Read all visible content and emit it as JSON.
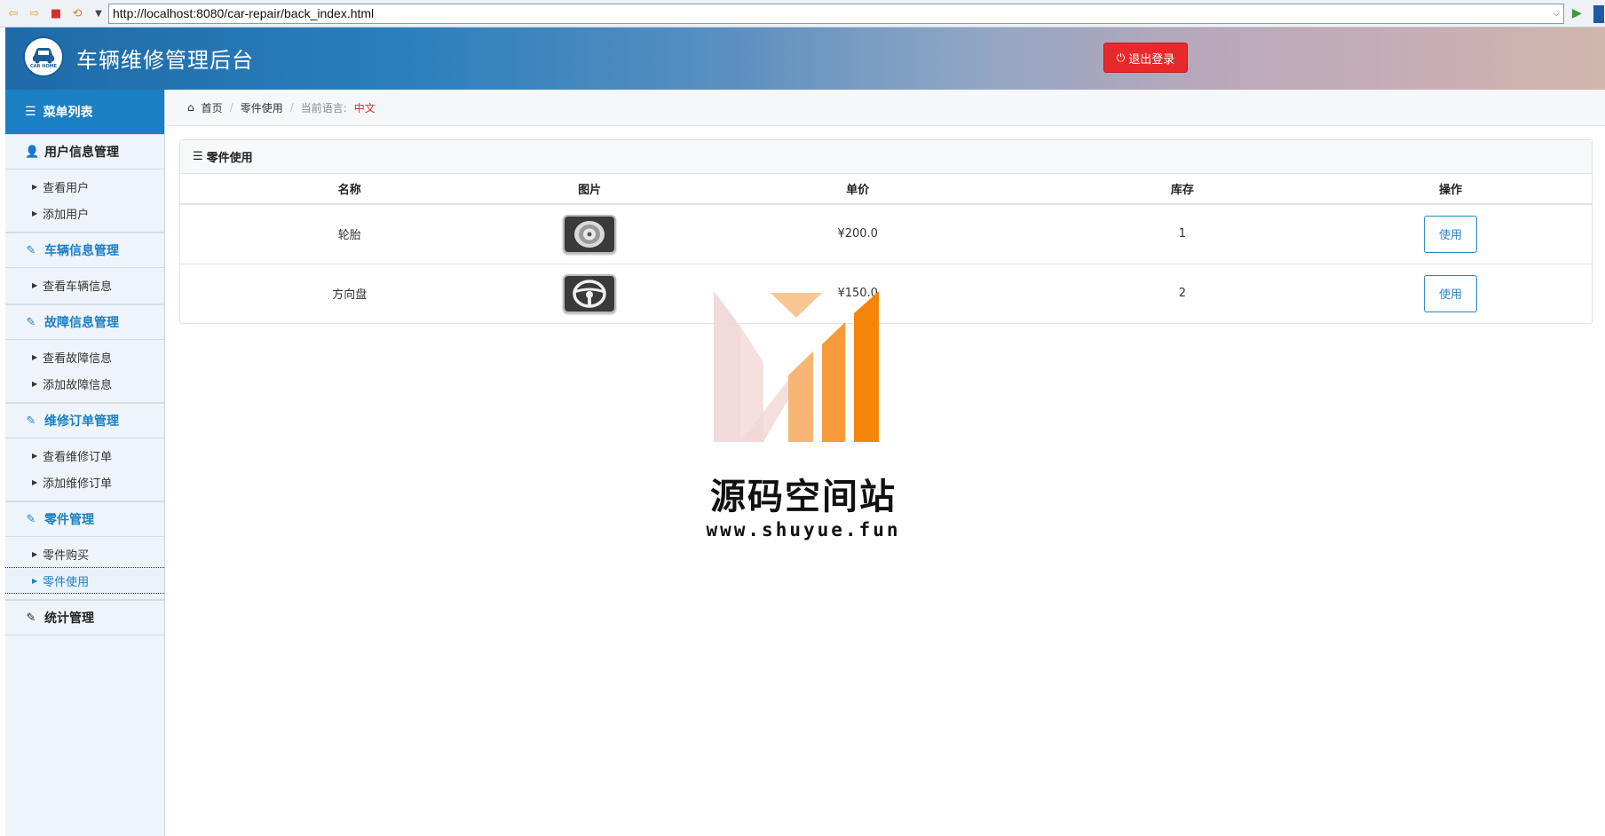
{
  "browser": {
    "url": "http://localhost:8080/car-repair/back_index.html"
  },
  "header": {
    "title": "车辆维修管理后台",
    "logo_text": "CAR HOME",
    "logout_label": "退出登录"
  },
  "sidebar": {
    "menu_title": "菜单列表",
    "groups": [
      {
        "title": "用户信息管理",
        "items": [
          "查看用户",
          "添加用户"
        ]
      },
      {
        "title": "车辆信息管理",
        "items": [
          "查看车辆信息"
        ]
      },
      {
        "title": "故障信息管理",
        "items": [
          "查看故障信息",
          "添加故障信息"
        ]
      },
      {
        "title": "维修订单管理",
        "items": [
          "查看维修订单",
          "添加维修订单"
        ]
      },
      {
        "title": "零件管理",
        "items": [
          "零件购买",
          "零件使用"
        ]
      },
      {
        "title": "统计管理",
        "items": []
      }
    ]
  },
  "breadcrumb": {
    "home": "首页",
    "current": "零件使用",
    "lang_label": "当前语言:",
    "lang_value": "中文"
  },
  "panel": {
    "title": "零件使用",
    "columns": [
      "名称",
      "图片",
      "单价",
      "库存",
      "操作"
    ],
    "rows": [
      {
        "name": "轮胎",
        "image": "tire-icon",
        "price": "¥200.0",
        "stock": "1",
        "action": "使用"
      },
      {
        "name": "方向盘",
        "image": "steering-wheel-icon",
        "price": "¥150.0",
        "stock": "2",
        "action": "使用"
      }
    ]
  },
  "watermark": {
    "title": "源码空间站",
    "url": "www.shuyue.fun"
  },
  "colors": {
    "header_blue": "#1f6aa8",
    "menu_blue": "#1b7fc4",
    "logout_red": "#e8292b",
    "price_green": "#2fa78a"
  }
}
